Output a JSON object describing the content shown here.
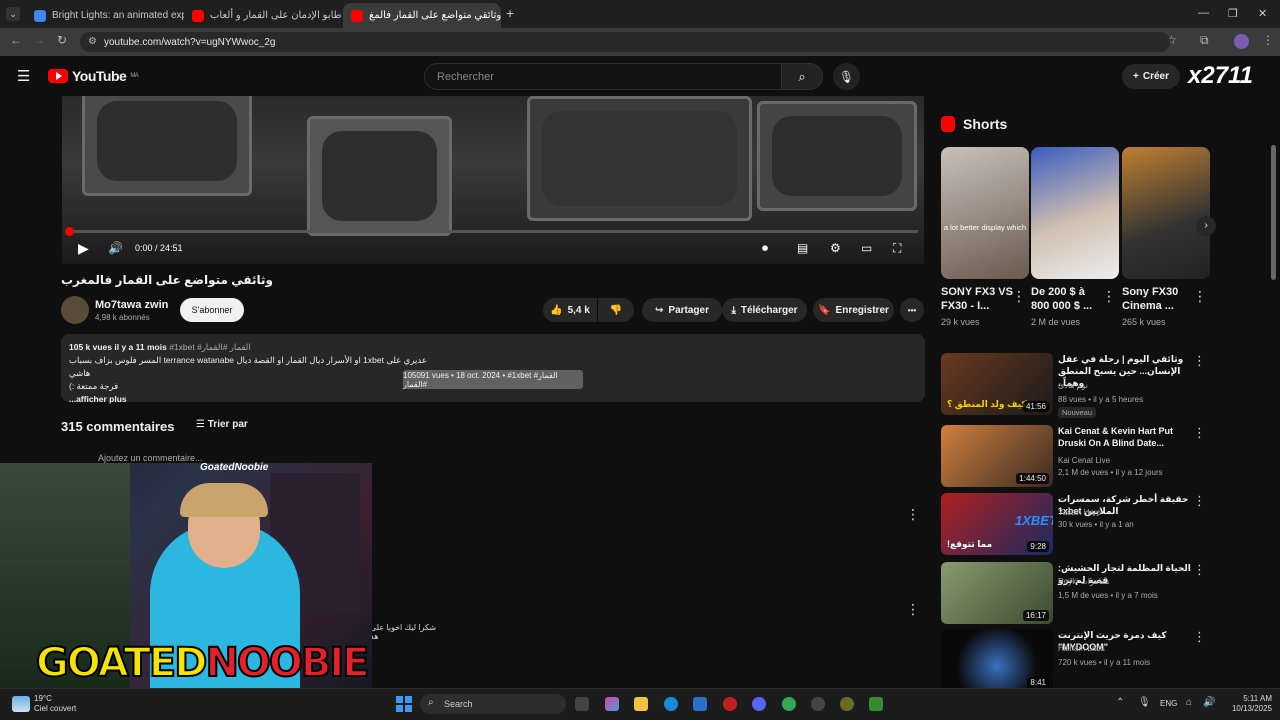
{
  "browser": {
    "tabs": [
      {
        "title": "Bright Lights: an animated expl"
      },
      {
        "title": "طابو الإدمان على القمار و ألعاب"
      },
      {
        "title": "وثائقي متواضع على القمار فالمغ"
      }
    ],
    "url": "youtube.com/watch?v=ugNYWwoc_2g",
    "new_tab": "+",
    "window_controls": [
      "—",
      "❐",
      "✕"
    ]
  },
  "youtube": {
    "logo_text": "YouTube",
    "region": "MA",
    "search_placeholder": "Rechercher",
    "create_label": "Créer",
    "overlay_brand": "x2711"
  },
  "player": {
    "time": "0:00 / 24:51",
    "progress_fraction": 0.0
  },
  "video": {
    "title": "وثائقي متواضع على القمار فالمغرب",
    "channel": "Mo7tawa zwin",
    "subscribers": "4,98 k abonnés",
    "subscribe_label": "S'abonner",
    "likes": "5,4 k",
    "share_label": "Partager",
    "download_label": "Télécharger",
    "save_label": "Enregistrer",
    "more_label": "•••"
  },
  "description": {
    "meta": "105 k vues  il y a 11 mois",
    "tags": "#1xbet #القمار #القمار",
    "line1": "عديري على 1xbet او الأسرار ديال القمار او القصة ديال terrance watanabe المسر فلوس بزاف بسباب هاشي",
    "line2": "فرجة ممتعة :)",
    "more": "...afficher plus",
    "tooltip": "105091 vues • 18 oct. 2024 • #1xbet #القمار #القمار"
  },
  "comments": {
    "count": "315 commentaires",
    "sort_label": "Trier par",
    "add_placeholder": "Ajoutez un commentaire...",
    "visible_comment": "شكرا ليك اخويا على هد"
  },
  "webcam": {
    "tag": "GoatedNoobie",
    "logo_part1": "GOATED",
    "logo_part2": "NOOBIE"
  },
  "shorts": {
    "section_title": "Shorts",
    "items": [
      {
        "title": "SONY FX3 VS FX30 - I...",
        "views": "29 k vues",
        "caption": "a lot better display which"
      },
      {
        "title": "De 200 $ à 800 000 $ ...",
        "views": "2 M de vues"
      },
      {
        "title": "Sony FX30 Cinema ...",
        "views": "265 k vues"
      }
    ]
  },
  "recommendations": [
    {
      "title": "وثائقي اليوم | رحلة في عقل الإنسان... حين يسبح المنطق وهماً .",
      "channel": "نوم هادئ",
      "views": "88 vues • il y a 5 heures",
      "badge": "Nouveau",
      "duration": "41:56",
      "overlay": "كيف ولد المنطق ؟"
    },
    {
      "title": "Kai Cenat & Kevin Hart Put Druski On A Blind Date...",
      "channel": "Kai Cenat Live",
      "views": "2,1 M de vues • il y a 12 jours",
      "duration": "1:44:50"
    },
    {
      "title": "حقيقة أخطر شركة، سمسرات الملايين 1xbet",
      "channel": "Yassin Haro",
      "views": "30 k vues • il y a 1 an",
      "duration": "9:28",
      "overlay": "مما تتوقع!"
    },
    {
      "title": "الحياة المظلمة لتجار الحشيش: قصة لم ترو",
      "channel": "Royki مقامرات",
      "views": "1,5 M de vues • il y a 7 mois",
      "duration": "16:17"
    },
    {
      "title": "كيف دمرة حريث الإنترنت \"MYDOOM\"",
      "channel": "Hisham Labs",
      "views": "720 k vues • il y a 11 mois",
      "duration": "8:41"
    }
  ],
  "taskbar": {
    "weather_temp": "19°C",
    "weather_desc": "Ciel couvert",
    "search_label": "Search",
    "lang": "ENG",
    "time": "5:11 AM",
    "date": "10/13/2025"
  }
}
